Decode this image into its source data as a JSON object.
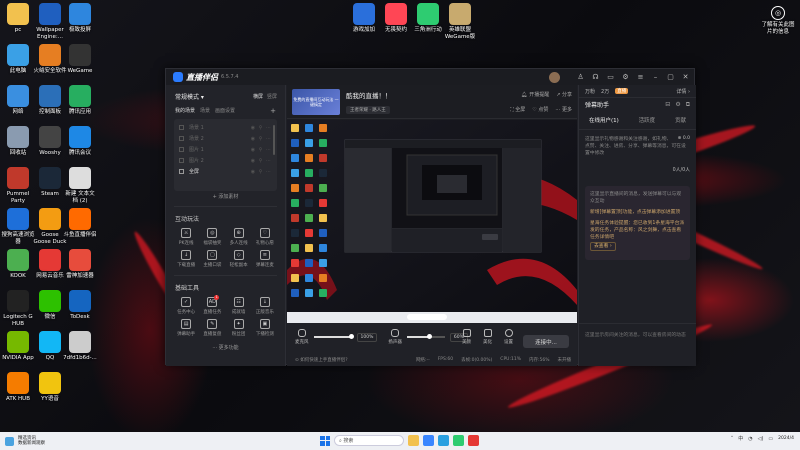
{
  "desktop": {
    "left_icons": [
      {
        "label": "pc",
        "icon": "folder-icon",
        "color": "#f2c14e"
      },
      {
        "label": "Wallpaper\nEngine:...",
        "icon": "wallpaper-engine-icon",
        "color": "#1f5fbf"
      },
      {
        "label": "极致投屏",
        "icon": "cast-icon",
        "color": "#2e86de"
      },
      {
        "label": "此电脑",
        "icon": "computer-icon",
        "color": "#3aa0e6"
      },
      {
        "label": "火绒安全软件",
        "icon": "huorong-icon",
        "color": "#e67e22"
      },
      {
        "label": "WeGame",
        "icon": "wegame-icon",
        "color": "#333333"
      },
      {
        "label": "网络",
        "icon": "network-icon",
        "color": "#3a8fe0"
      },
      {
        "label": "控制面板",
        "icon": "control-panel-icon",
        "color": "#2b6fb8"
      },
      {
        "label": "腾讯应用",
        "icon": "tencent-store-icon",
        "color": "#27ae60"
      },
      {
        "label": "回收站",
        "icon": "recycle-bin-icon",
        "color": "#8a9bb0"
      },
      {
        "label": "Wooshy",
        "icon": "wooshy-icon",
        "color": "#444444"
      },
      {
        "label": "腾讯会议",
        "icon": "tencent-meeting-icon",
        "color": "#1e88e5"
      },
      {
        "label": "Pummel\nParty",
        "icon": "pummel-party-icon",
        "color": "#c0392b"
      },
      {
        "label": "Steam",
        "icon": "steam-icon",
        "color": "#1b2838"
      },
      {
        "label": "新建 文本文\n档 (2)",
        "icon": "text-file-icon",
        "color": "#dddddd"
      },
      {
        "label": "搜狗高速浏览\n器",
        "icon": "sogou-browser-icon",
        "color": "#1e6fd9"
      },
      {
        "label": "Goose\nGoose Duck",
        "icon": "goose-icon",
        "color": "#f39c12"
      },
      {
        "label": "斗鱼直播伴侣",
        "icon": "douyu-icon",
        "color": "#ff6a00"
      },
      {
        "label": "KOOK",
        "icon": "kook-icon",
        "color": "#4caf50"
      },
      {
        "label": "网易云音乐",
        "icon": "netease-music-icon",
        "color": "#e53935"
      },
      {
        "label": "雷神加速器",
        "icon": "leishen-icon",
        "color": "#e74c3c"
      },
      {
        "label": "Logitech G\nHUB",
        "icon": "logitech-icon",
        "color": "#222222"
      },
      {
        "label": "微信",
        "icon": "wechat-icon",
        "color": "#2dc100"
      },
      {
        "label": "ToDesk",
        "icon": "todesk-icon",
        "color": "#1565c0"
      },
      {
        "label": "NVIDIA App",
        "icon": "nvidia-icon",
        "color": "#76b900"
      },
      {
        "label": "QQ",
        "icon": "qq-icon",
        "color": "#12b7f5"
      },
      {
        "label": "7dfd1b6d-...",
        "icon": "file-icon",
        "color": "#cccccc"
      },
      {
        "label": "ATK HUB",
        "icon": "atk-icon",
        "color": "#f57c00"
      },
      {
        "label": "YY语音",
        "icon": "yy-icon",
        "color": "#f1c40f"
      }
    ],
    "top_icons": [
      {
        "label": "游戏加加",
        "icon": "youxijiajia-icon",
        "color": "#2a6fdb"
      },
      {
        "label": "无畏契约",
        "icon": "valorant-icon",
        "color": "#ff4655"
      },
      {
        "label": "三角洲行动",
        "icon": "delta-force-icon",
        "color": "#2ecc71"
      },
      {
        "label": "英雄联盟\nWeGame版",
        "icon": "lol-icon",
        "color": "#c8aa6e"
      }
    ],
    "right_icon": {
      "label": "了解有关此图\n片的信息",
      "icon": "camera-info-icon"
    }
  },
  "app": {
    "name": "直播伴侣",
    "version": "6.5.7.4",
    "window_controls": [
      "shirt-icon",
      "headset-icon",
      "chat-icon",
      "settings-icon",
      "menu-icon",
      "minimize-icon",
      "maximize-icon",
      "close-icon"
    ],
    "left": {
      "mode": "常规模式 ▾",
      "mode_opts": [
        "横屏",
        "竖屏"
      ],
      "scene_tabs": [
        "我的场景",
        "场景",
        "画面设置"
      ],
      "sources": [
        {
          "label": "场景 1",
          "on": false
        },
        {
          "label": "场景 2",
          "on": false
        },
        {
          "label": "图片 1",
          "on": false
        },
        {
          "label": "图片 2",
          "on": false
        },
        {
          "label": "全屏",
          "on": true
        }
      ],
      "add_source": "+ 添加素材",
      "interact_title": "互动玩法",
      "interact_tools": [
        {
          "label": "PK连线",
          "glyph": "⚔"
        },
        {
          "label": "福袋抽奖",
          "glyph": "◎"
        },
        {
          "label": "多人连线",
          "glyph": "⊕"
        },
        {
          "label": "礼物心愿",
          "glyph": "♡"
        },
        {
          "label": "下载直播",
          "glyph": "↓"
        },
        {
          "label": "主播口袋",
          "glyph": "▢"
        },
        {
          "label": "轻松副本",
          "glyph": "◇"
        },
        {
          "label": "弹幕连麦",
          "glyph": "≡"
        }
      ],
      "basic_title": "基础工具",
      "basic_tools": [
        {
          "label": "任务中心",
          "glyph": "✓",
          "badge": ""
        },
        {
          "label": "直播任务",
          "glyph": "AD",
          "badge": "1"
        },
        {
          "label": "成就墙",
          "glyph": "☷",
          "badge": ""
        },
        {
          "label": "正版音乐",
          "glyph": "↓",
          "badge": ""
        },
        {
          "label": "弹幕助手",
          "glyph": "▤",
          "badge": ""
        },
        {
          "label": "直播复盘",
          "glyph": "✎",
          "badge": ""
        },
        {
          "label": "粉丝团",
          "glyph": "✦",
          "badge": ""
        },
        {
          "label": "下播检测",
          "glyph": "▣",
          "badge": ""
        }
      ],
      "more": "··· 更多功能"
    },
    "center": {
      "cover_text": "免费的直播间互动玩法 一键搞定",
      "room_title": "酷我的直播！！",
      "room_tag": "王者荣耀 · 路人王",
      "actions_top": [
        "开播提醒",
        "分享"
      ],
      "actions_bottom": [
        "全屏",
        "点赞",
        "更多"
      ],
      "audio": {
        "mic_label": "麦克风",
        "mic_pct": "100%",
        "mic_level": 100,
        "speaker_label": "扬声器",
        "speaker_pct": "60%",
        "speaker_level": 60
      },
      "controls": [
        {
          "label": "美颜"
        },
        {
          "label": "美化"
        },
        {
          "label": "设置"
        }
      ],
      "go_live": "连接中...",
      "hint": "⊙ 如何快速上手直播伴侣?",
      "stats": [
        "网络:--",
        "FPS:60",
        "丢帧:0(0.00%)",
        "CPU:11%",
        "内存:56%",
        "未开播"
      ]
    },
    "right": {
      "top_items": [
        "万粉",
        "2万"
      ],
      "badge": "直播",
      "detail": "详情 ›",
      "panel_title": "弹幕助手",
      "tabs": [
        "在线用户(1)",
        "活跃度",
        "贡献"
      ],
      "body_text": "这里显示礼物感谢和关注感谢，如礼物、点赞、关注、进房、分享、弹幕等消息，可在设置中修改",
      "meta_1": "⊕ 0.0",
      "meta_2": "0人/0人",
      "notice_1": "这里显示直播间的消息，发送弹幕可以与观众互动",
      "notice_2": "新增[弹幕置顶]功能，点击弹幕添加进置顶",
      "notice_3": "星海任务体验提醒：您已收到1条星海平台派发的任务，产品名称：风之剑舞，点击查看任务详情吧",
      "notice_link": "去查看 ›",
      "bottom_text": "这里显示房间关注的消息，可以查看房间的动态"
    }
  },
  "taskbar": {
    "weather_title": "精选资讯",
    "weather_sub": "数据新闻观察",
    "search_placeholder": "搜索",
    "apps": [
      {
        "icon": "explorer-icon",
        "color": "#f2c14e"
      },
      {
        "icon": "store-icon",
        "color": "#3a86ff"
      },
      {
        "icon": "edge-icon",
        "color": "#2aa0e0"
      },
      {
        "icon": "delta-force-taskbar-icon",
        "color": "#2ecc71"
      },
      {
        "icon": "douyin-live-taskbar-icon",
        "color": "#e53935"
      }
    ],
    "clock_time": "",
    "clock_date": "2024/4"
  }
}
